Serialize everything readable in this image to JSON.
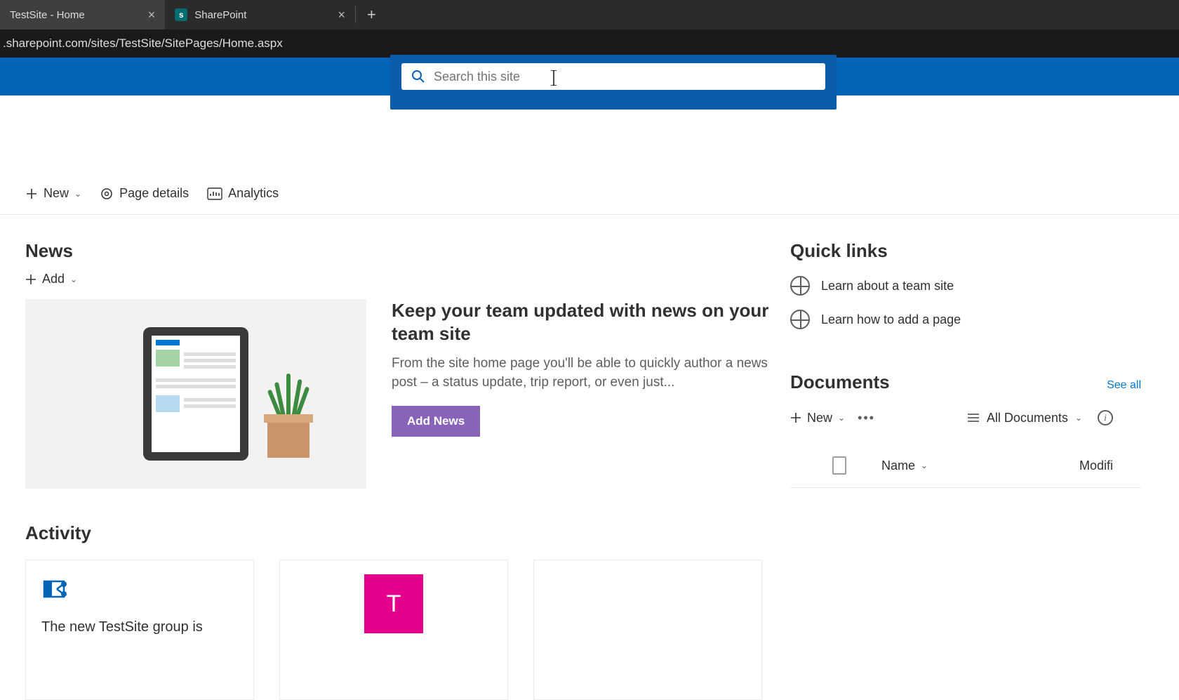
{
  "browser": {
    "tabs": [
      {
        "title": "TestSite - Home",
        "active": true
      },
      {
        "title": "SharePoint",
        "active": false
      }
    ],
    "url": ".sharepoint.com/sites/TestSite/SitePages/Home.aspx"
  },
  "search": {
    "placeholder": "Search this site"
  },
  "commandbar": {
    "new": "New",
    "page_details": "Page details",
    "analytics": "Analytics"
  },
  "news": {
    "heading": "News",
    "add": "Add",
    "promo_title": "Keep your team updated with news on your team site",
    "promo_body": "From the site home page you'll be able to quickly author a news post – a status update, trip report, or even just...",
    "button": "Add News"
  },
  "activity": {
    "heading": "Activity",
    "card1_text": "The new TestSite group is",
    "tile_letter": "T"
  },
  "quicklinks": {
    "heading": "Quick links",
    "items": [
      "Learn about a team site",
      "Learn how to add a page"
    ]
  },
  "documents": {
    "heading": "Documents",
    "see_all": "See all",
    "new": "New",
    "view": "All Documents",
    "columns": {
      "name": "Name",
      "modified": "Modifi"
    }
  }
}
